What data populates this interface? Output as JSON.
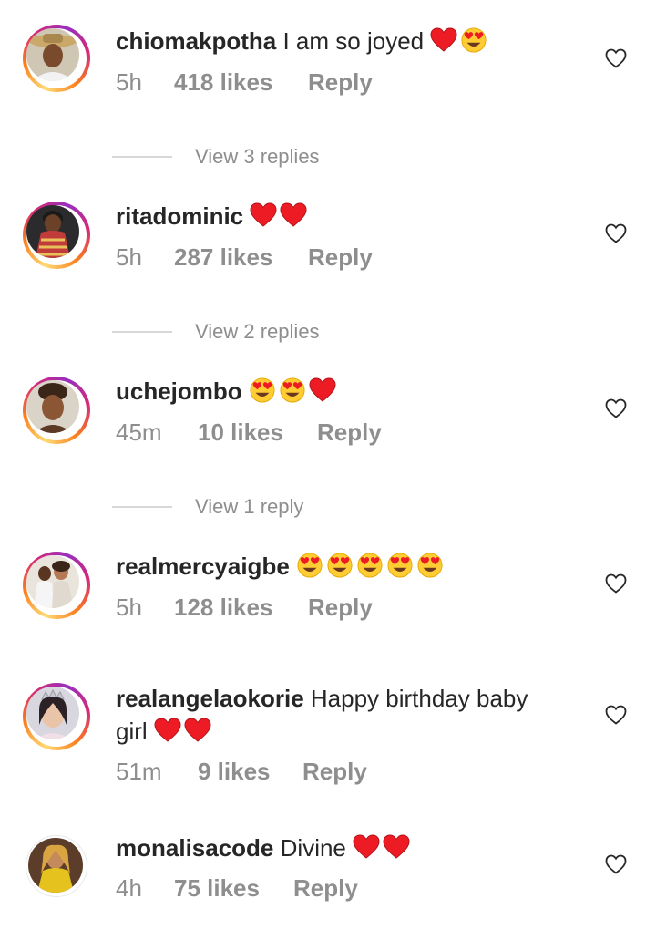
{
  "colors": {
    "primary_text": "#262626",
    "secondary_text": "#8e8e8e",
    "heart_red": "#ed1c24",
    "story_ring": [
      "#feda75",
      "#fa7e1e",
      "#d62976",
      "#962fbf"
    ]
  },
  "comments": [
    {
      "username": "chiomakpotha",
      "message": "I am so joyed",
      "emojis": [
        "red-heart",
        "heart-eyes"
      ],
      "time": "5h",
      "likes": "418 likes",
      "reply_label": "Reply",
      "avatar": "portrait-hat",
      "story_ring": true
    },
    {
      "username": "ritadominic",
      "message": "",
      "emojis": [
        "red-heart",
        "red-heart"
      ],
      "time": "5h",
      "likes": "287 likes",
      "reply_label": "Reply",
      "avatar": "portrait-patterned-dress",
      "story_ring": true
    },
    {
      "username": "uchejombo",
      "message": "",
      "emojis": [
        "heart-eyes",
        "heart-eyes",
        "red-heart"
      ],
      "time": "45m",
      "likes": "10 likes",
      "reply_label": "Reply",
      "avatar": "portrait-updo",
      "story_ring": true
    },
    {
      "username": "realmercyaigbe",
      "message": "",
      "emojis": [
        "heart-eyes",
        "heart-eyes",
        "heart-eyes",
        "heart-eyes",
        "heart-eyes"
      ],
      "time": "5h",
      "likes": "128 likes",
      "reply_label": "Reply",
      "avatar": "couple-photo",
      "story_ring": true
    },
    {
      "username": "realangelaokorie",
      "message": "Happy birthday baby",
      "message_line2": "girl",
      "emojis": [
        "red-heart",
        "red-heart"
      ],
      "time": "51m",
      "likes": "9 likes",
      "reply_label": "Reply",
      "avatar": "portrait-crown",
      "story_ring": true
    },
    {
      "username": "monalisacode",
      "message": "Divine",
      "emojis": [
        "red-heart",
        "red-heart"
      ],
      "time": "4h",
      "likes": "75 likes",
      "reply_label": "Reply",
      "avatar": "portrait-yellow-dress",
      "story_ring": false
    }
  ],
  "reply_threads": [
    {
      "label": "View 3 replies"
    },
    {
      "label": "View 2 replies"
    },
    {
      "label": "View 1 reply"
    }
  ]
}
